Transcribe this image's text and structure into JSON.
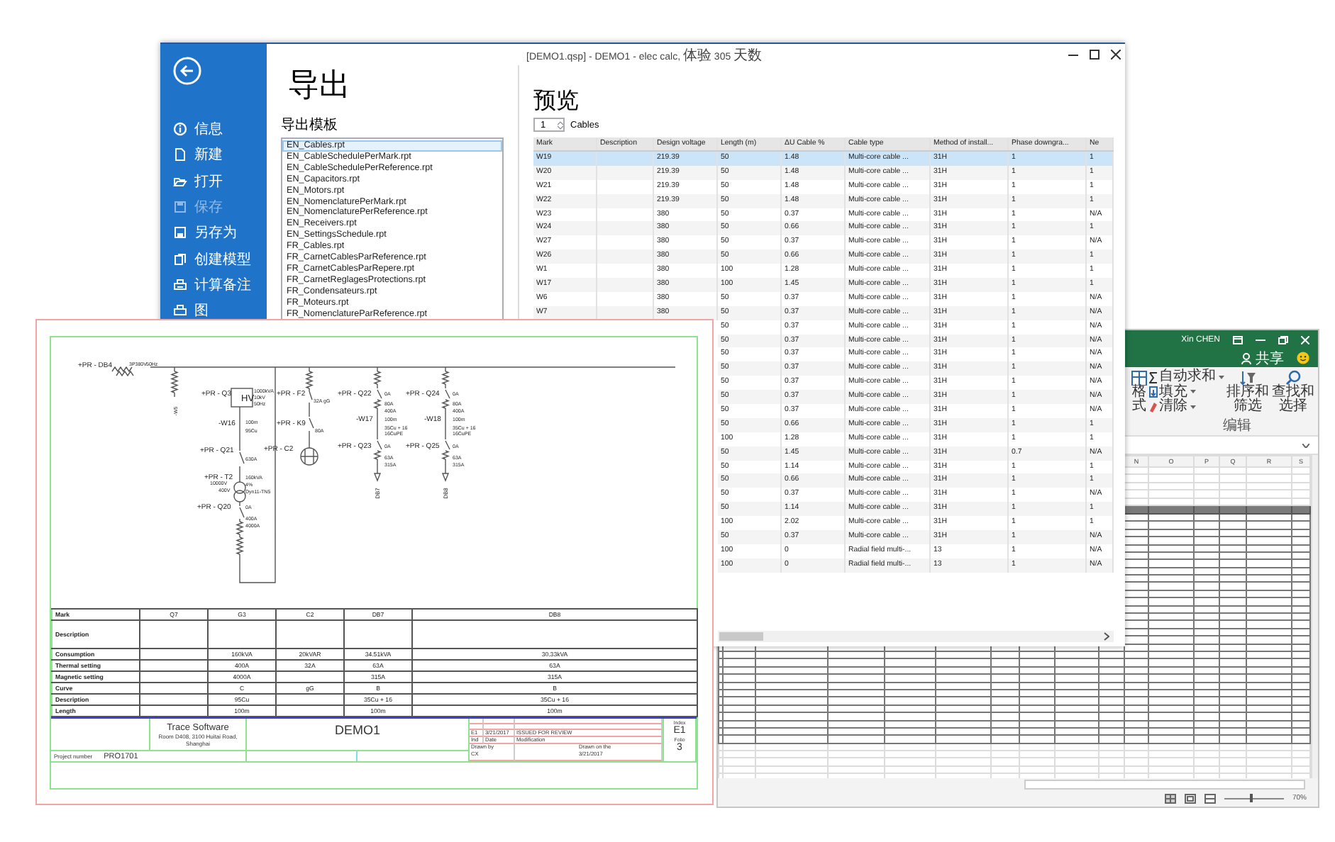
{
  "excel_window": {
    "user": "Xin CHEN",
    "share": "共享",
    "ribbon": {
      "format": "格式",
      "autosum": "自动求和",
      "fill": "填充",
      "clear": "清除",
      "sort_filter": "排序和筛选",
      "find_select": "查找和选择",
      "group": "编辑"
    },
    "column_headers": [
      "N",
      "O",
      "P",
      "Q",
      "R",
      "S"
    ],
    "zoom_slider": {
      "level": 0.45
    },
    "zoom": "70%"
  },
  "elec_window": {
    "title": "[DEMO1.qsp] - DEMO1 - elec calc, 体验 305 天数",
    "sidebar": {
      "items": [
        {
          "label": "信息",
          "disabled": false
        },
        {
          "label": "新建",
          "disabled": false
        },
        {
          "label": "打开",
          "disabled": false
        },
        {
          "label": "保存",
          "disabled": true
        },
        {
          "label": "另存为",
          "disabled": false
        },
        {
          "label": "创建模型",
          "disabled": false
        },
        {
          "label": "计算备注",
          "disabled": false
        },
        {
          "label": "图",
          "disabled": false
        }
      ]
    },
    "export": {
      "heading": "导出",
      "templates_label": "导出模板",
      "templates": [
        {
          "name": "EN_Cables.rpt",
          "selected": true
        },
        {
          "name": "EN_CableSchedulePerMark.rpt",
          "selected": false
        },
        {
          "name": "EN_CableSchedulePerReference.rpt",
          "selected": false
        },
        {
          "name": "EN_Capacitors.rpt",
          "selected": false
        },
        {
          "name": "EN_Motors.rpt",
          "selected": false
        },
        {
          "name": "EN_NomenclaturePerMark.rpt",
          "selected": false
        },
        {
          "name": "EN_NomenclaturePerReference.rpt",
          "selected": false
        },
        {
          "name": "EN_Receivers.rpt",
          "selected": false
        },
        {
          "name": "EN_SettingsSchedule.rpt",
          "selected": false
        },
        {
          "name": "FR_Cables.rpt",
          "selected": false
        },
        {
          "name": "FR_CarnetCablesParReference.rpt",
          "selected": false
        },
        {
          "name": "FR_CarnetCablesParRepere.rpt",
          "selected": false
        },
        {
          "name": "FR_CarnetReglagesProtections.rpt",
          "selected": false
        },
        {
          "name": "FR_Condensateurs.rpt",
          "selected": false
        },
        {
          "name": "FR_Moteurs.rpt",
          "selected": false
        },
        {
          "name": "FR_NomenclatureParReference.rpt",
          "selected": false
        }
      ]
    },
    "preview": {
      "heading": "预览",
      "count": "1",
      "count_label": "Cables",
      "columns": [
        "Mark",
        "Description",
        "Design voltage",
        "Length (m)",
        "ΔU Cable %",
        "Cable type",
        "Method of install...",
        "Phase downgra...",
        "Ne"
      ],
      "rows": [
        {
          "mark": "W19",
          "voltage": "219.39",
          "length": "50",
          "du": "1.48",
          "type": "Multi-core cable ...",
          "method": "31H",
          "phase": "1",
          "neutral": "1",
          "selected": true
        },
        {
          "mark": "W20",
          "voltage": "219.39",
          "length": "50",
          "du": "1.48",
          "type": "Multi-core cable ...",
          "method": "31H",
          "phase": "1",
          "neutral": "1",
          "selected": false
        },
        {
          "mark": "W21",
          "voltage": "219.39",
          "length": "50",
          "du": "1.48",
          "type": "Multi-core cable ...",
          "method": "31H",
          "phase": "1",
          "neutral": "1",
          "selected": false
        },
        {
          "mark": "W22",
          "voltage": "219.39",
          "length": "50",
          "du": "1.48",
          "type": "Multi-core cable ...",
          "method": "31H",
          "phase": "1",
          "neutral": "1",
          "selected": false
        },
        {
          "mark": "W23",
          "voltage": "380",
          "length": "50",
          "du": "0.37",
          "type": "Multi-core cable ...",
          "method": "31H",
          "phase": "1",
          "neutral": "N/A",
          "selected": false
        },
        {
          "mark": "W24",
          "voltage": "380",
          "length": "50",
          "du": "0.66",
          "type": "Multi-core cable ...",
          "method": "31H",
          "phase": "1",
          "neutral": "1",
          "selected": false
        },
        {
          "mark": "W27",
          "voltage": "380",
          "length": "50",
          "du": "0.37",
          "type": "Multi-core cable ...",
          "method": "31H",
          "phase": "1",
          "neutral": "N/A",
          "selected": false
        },
        {
          "mark": "W26",
          "voltage": "380",
          "length": "50",
          "du": "0.66",
          "type": "Multi-core cable ...",
          "method": "31H",
          "phase": "1",
          "neutral": "1",
          "selected": false
        },
        {
          "mark": "W1",
          "voltage": "380",
          "length": "100",
          "du": "1.28",
          "type": "Multi-core cable ...",
          "method": "31H",
          "phase": "1",
          "neutral": "1",
          "selected": false
        },
        {
          "mark": "W17",
          "voltage": "380",
          "length": "100",
          "du": "1.45",
          "type": "Multi-core cable ...",
          "method": "31H",
          "phase": "1",
          "neutral": "1",
          "selected": false
        },
        {
          "mark": "W6",
          "voltage": "380",
          "length": "50",
          "du": "0.37",
          "type": "Multi-core cable ...",
          "method": "31H",
          "phase": "1",
          "neutral": "N/A",
          "selected": false
        },
        {
          "mark": "W7",
          "voltage": "380",
          "length": "50",
          "du": "0.37",
          "type": "Multi-core cable ...",
          "method": "31H",
          "phase": "1",
          "neutral": "N/A",
          "selected": false
        },
        {
          "length": "50",
          "du": "0.37",
          "type": "Multi-core cable ...",
          "method": "31H",
          "phase": "1",
          "neutral": "N/A",
          "selected": false
        },
        {
          "length": "50",
          "du": "0.37",
          "type": "Multi-core cable ...",
          "method": "31H",
          "phase": "1",
          "neutral": "N/A",
          "selected": false
        },
        {
          "length": "50",
          "du": "0.37",
          "type": "Multi-core cable ...",
          "method": "31H",
          "phase": "1",
          "neutral": "N/A",
          "selected": false
        },
        {
          "length": "50",
          "du": "0.37",
          "type": "Multi-core cable ...",
          "method": "31H",
          "phase": "1",
          "neutral": "N/A",
          "selected": false
        },
        {
          "length": "50",
          "du": "0.37",
          "type": "Multi-core cable ...",
          "method": "31H",
          "phase": "1",
          "neutral": "N/A",
          "selected": false
        },
        {
          "length": "50",
          "du": "0.37",
          "type": "Multi-core cable ...",
          "method": "31H",
          "phase": "1",
          "neutral": "N/A",
          "selected": false
        },
        {
          "length": "50",
          "du": "0.37",
          "type": "Multi-core cable ...",
          "method": "31H",
          "phase": "1",
          "neutral": "N/A",
          "selected": false
        },
        {
          "length": "50",
          "du": "0.66",
          "type": "Multi-core cable ...",
          "method": "31H",
          "phase": "1",
          "neutral": "1",
          "selected": false
        },
        {
          "length": "100",
          "du": "1.28",
          "type": "Multi-core cable ...",
          "method": "31H",
          "phase": "1",
          "neutral": "1",
          "selected": false
        },
        {
          "length": "50",
          "du": "1.45",
          "type": "Multi-core cable ...",
          "method": "31H",
          "phase": "0.7",
          "neutral": "N/A",
          "selected": false
        },
        {
          "length": "50",
          "du": "1.14",
          "type": "Multi-core cable ...",
          "method": "31H",
          "phase": "1",
          "neutral": "1",
          "selected": false
        },
        {
          "length": "50",
          "du": "0.66",
          "type": "Multi-core cable ...",
          "method": "31H",
          "phase": "1",
          "neutral": "1",
          "selected": false
        },
        {
          "length": "50",
          "du": "0.37",
          "type": "Multi-core cable ...",
          "method": "31H",
          "phase": "1",
          "neutral": "N/A",
          "selected": false
        },
        {
          "length": "50",
          "du": "1.14",
          "type": "Multi-core cable ...",
          "method": "31H",
          "phase": "1",
          "neutral": "1",
          "selected": false
        },
        {
          "length": "100",
          "du": "2.02",
          "type": "Multi-core cable ...",
          "method": "31H",
          "phase": "1",
          "neutral": "1",
          "selected": false
        },
        {
          "length": "50",
          "du": "0.37",
          "type": "Multi-core cable ...",
          "method": "31H",
          "phase": "1",
          "neutral": "N/A",
          "selected": false
        },
        {
          "length": "100",
          "du": "0",
          "type": "Radial field multi-...",
          "method": "13",
          "phase": "1",
          "neutral": "N/A",
          "selected": false
        },
        {
          "length": "100",
          "du": "0",
          "type": "Radial field multi-...",
          "method": "13",
          "phase": "1",
          "neutral": "N/A",
          "selected": false
        }
      ]
    }
  },
  "schematic_window": {
    "labels": [
      "+PR - DB4",
      "3P380V",
      "50Hz",
      "-W5",
      "+PR - Q3",
      "HV",
      "1000kVA",
      "10kV",
      "50Hz",
      "-W16",
      "100m",
      "95Cu",
      "+PR - Q21",
      "630A",
      "+PR - T2",
      "10000V",
      "400V",
      "160kVA",
      "4%",
      "Dyn11-TN5",
      "+PR - Q20",
      "0A",
      "400A",
      "4000A",
      "+PR - F2",
      "32A gG",
      "+PR - K9",
      "80A",
      "+PR - C2"
    ],
    "feeders": [
      {
        "labels": [
          "+PR - Q22",
          "0A",
          "80A",
          "400A",
          "-W17",
          "100m",
          "35Cu + 16",
          "16CuPE",
          "+PR - Q23",
          "0A",
          "63A",
          "315A",
          "DB7"
        ]
      },
      {
        "labels": [
          "+PR - Q24",
          "0A",
          "80A",
          "400A",
          "-W18",
          "100m",
          "35Cu + 16",
          "16CuPE",
          "+PR - Q25",
          "0A",
          "63A",
          "315A",
          "DB8"
        ]
      }
    ],
    "table": [
      {
        "label": "Mark",
        "kind": "short",
        "cells": [
          "Q7",
          "G3",
          "C2",
          "DB7",
          "DB8"
        ]
      },
      {
        "label": "Description",
        "kind": "tall",
        "cells": [
          "",
          "",
          "",
          "",
          ""
        ]
      },
      {
        "label": "Consumption",
        "kind": "short",
        "cells": [
          "",
          "160kVA",
          "20kVAR",
          "34.51kVA",
          "30.33kVA"
        ]
      },
      {
        "label": "Thermal setting",
        "kind": "short",
        "cells": [
          "",
          "400A",
          "32A",
          "63A",
          "63A"
        ]
      },
      {
        "label": "Magnetic setting",
        "kind": "short",
        "cells": [
          "",
          "4000A",
          "",
          "315A",
          "315A"
        ]
      },
      {
        "label": "Curve",
        "kind": "short",
        "cells": [
          "",
          "C",
          "gG",
          "B",
          "B"
        ]
      },
      {
        "label": "Description",
        "kind": "short",
        "cells": [
          "",
          "95Cu",
          "",
          "35Cu + 16",
          "35Cu + 16"
        ]
      },
      {
        "label": "Length",
        "kind": "short",
        "cells": [
          "",
          "100m",
          "",
          "100m",
          "100m"
        ]
      }
    ],
    "title_block": {
      "company": "Trace Software",
      "address": "Room D408, 3100 Huitai Road, Shanghai",
      "project_title": "DEMO1",
      "revision": [
        "E1",
        "3/21/2017",
        "ISSUED FOR REVIEW"
      ],
      "revision_headers": [
        "Ind",
        "Date",
        "Modification"
      ],
      "drawn_by_label": "Drawn by",
      "drawn_by": "CX",
      "drawn_on_label": "Drawn on the",
      "drawn_on": "3/21/2017",
      "index_label": "Index",
      "index": "E1",
      "folio_label": "Folio",
      "folio": "3",
      "project_number_label": "Project number",
      "project_number": "PRO1701"
    }
  }
}
